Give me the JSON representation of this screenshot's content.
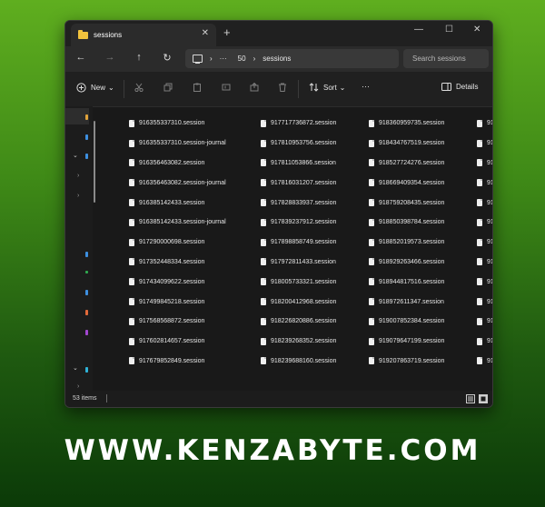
{
  "window": {
    "tab_title": "sessions",
    "tab_close": "✕",
    "new_tab": "+",
    "controls": {
      "minimize": "—",
      "maximize": "☐",
      "close": "✕"
    }
  },
  "address": {
    "back": "←",
    "forward": "→",
    "up": "↑",
    "refresh": "↻",
    "breadcrumbs": [
      "›",
      "···",
      "50",
      "›",
      "sessions"
    ],
    "search_placeholder": "Search sessions"
  },
  "commands": {
    "new_label": "New",
    "new_chevron": "⌄",
    "sort_label": "Sort",
    "sort_chevron": "⌄",
    "more": "···",
    "details_label": "Details"
  },
  "files": {
    "columns": [
      [
        "916355337310.session",
        "916355337310.session-journal",
        "916356463082.session",
        "916356463082.session-journal",
        "916385142433.session",
        "916385142433.session-journal",
        "917290000698.session",
        "917352448334.session",
        "917434099622.session",
        "917499845218.session",
        "917568568872.session",
        "917602814657.session",
        "917679852849.session"
      ],
      [
        "917717736872.session",
        "917810953756.session",
        "917811053866.session",
        "917816031207.session",
        "917828833937.session",
        "917839237912.session",
        "917898858749.session",
        "917972811433.session",
        "918005733321.session",
        "918200412968.session",
        "918226820886.session",
        "918239268352.session",
        "918239688160.session"
      ],
      [
        "918360959735.session",
        "918434767519.session",
        "918527724276.session",
        "918669409354.session",
        "918759208435.session",
        "918850398784.session",
        "918852019573.session",
        "918929263466.session",
        "918944817516.session",
        "918972611347.session",
        "919007852384.session",
        "919079647199.session",
        "919207863719.session"
      ],
      [
        "91",
        "91",
        "91",
        "91",
        "91",
        "91",
        "91",
        "91",
        "91",
        "91",
        "91",
        "91",
        "91"
      ]
    ]
  },
  "status": {
    "item_count": "53 items"
  },
  "footer": {
    "brand": "WWW.KENZABYTE.COM"
  }
}
